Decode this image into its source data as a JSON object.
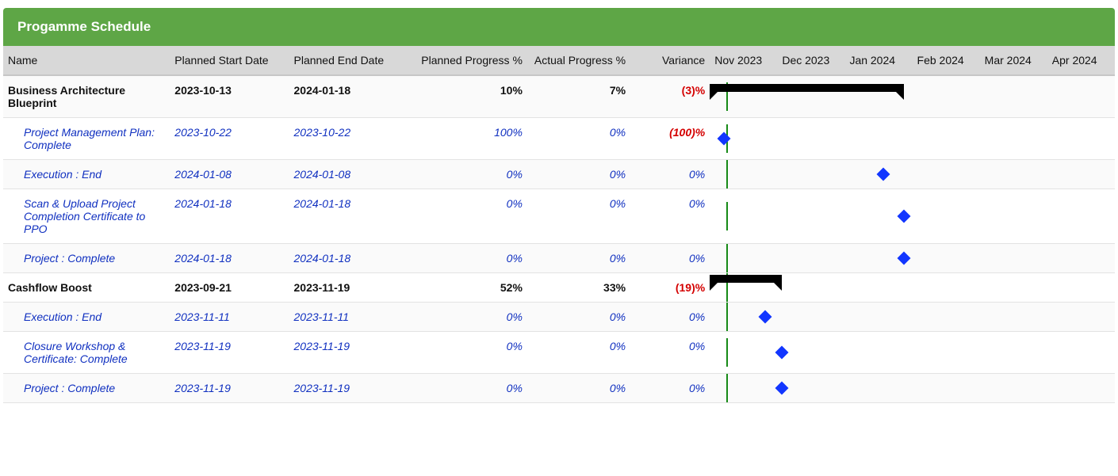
{
  "title": "Progamme Schedule",
  "columns": {
    "name": "Name",
    "planned_start": "Planned Start Date",
    "planned_end": "Planned End Date",
    "planned_progress": "Planned Progress %",
    "actual_progress": "Actual Progress %",
    "variance": "Variance"
  },
  "months": [
    "Nov 2023",
    "Dec 2023",
    "Jan 2024",
    "Feb 2024",
    "Mar 2024",
    "Apr 2024"
  ],
  "timeline": {
    "start": "2023-10-15",
    "end": "2024-04-30",
    "today": "2023-10-23"
  },
  "rows": [
    {
      "type": "summary",
      "name": "Business Architecture Blueprint",
      "planned_start": "2023-10-13",
      "planned_end": "2024-01-18",
      "planned_progress": "10%",
      "actual_progress": "7%",
      "variance": "(3)%",
      "variance_negative": true,
      "bar": {
        "start": "2023-10-13",
        "end": "2024-01-18"
      }
    },
    {
      "type": "child",
      "name": "Project Management Plan: Complete",
      "planned_start": "2023-10-22",
      "planned_end": "2023-10-22",
      "planned_progress": "100%",
      "actual_progress": "0%",
      "variance": "(100)%",
      "variance_negative": true,
      "milestone": "2023-10-22"
    },
    {
      "type": "child",
      "name": "Execution : End",
      "planned_start": "2024-01-08",
      "planned_end": "2024-01-08",
      "planned_progress": "0%",
      "actual_progress": "0%",
      "variance": "0%",
      "variance_negative": false,
      "milestone": "2024-01-08"
    },
    {
      "type": "child",
      "name": "Scan & Upload Project Completion Certificate to PPO",
      "planned_start": "2024-01-18",
      "planned_end": "2024-01-18",
      "planned_progress": "0%",
      "actual_progress": "0%",
      "variance": "0%",
      "variance_negative": false,
      "milestone": "2024-01-18"
    },
    {
      "type": "child",
      "name": "Project : Complete",
      "planned_start": "2024-01-18",
      "planned_end": "2024-01-18",
      "planned_progress": "0%",
      "actual_progress": "0%",
      "variance": "0%",
      "variance_negative": false,
      "milestone": "2024-01-18"
    },
    {
      "type": "summary",
      "name": "Cashflow Boost",
      "planned_start": "2023-09-21",
      "planned_end": "2023-11-19",
      "planned_progress": "52%",
      "actual_progress": "33%",
      "variance": "(19)%",
      "variance_negative": true,
      "bar": {
        "start": "2023-09-21",
        "end": "2023-11-19"
      }
    },
    {
      "type": "child",
      "name": "Execution : End",
      "planned_start": "2023-11-11",
      "planned_end": "2023-11-11",
      "planned_progress": "0%",
      "actual_progress": "0%",
      "variance": "0%",
      "variance_negative": false,
      "milestone": "2023-11-11"
    },
    {
      "type": "child",
      "name": "Closure Workshop & Certificate: Complete",
      "planned_start": "2023-11-19",
      "planned_end": "2023-11-19",
      "planned_progress": "0%",
      "actual_progress": "0%",
      "variance": "0%",
      "variance_negative": false,
      "milestone": "2023-11-19"
    },
    {
      "type": "child",
      "name": "Project : Complete",
      "planned_start": "2023-11-19",
      "planned_end": "2023-11-19",
      "planned_progress": "0%",
      "actual_progress": "0%",
      "variance": "0%",
      "variance_negative": false,
      "milestone": "2023-11-19"
    }
  ],
  "chart_data": {
    "type": "gantt",
    "title": "Progamme Schedule",
    "x_axis": {
      "start": "2023-10-15",
      "end": "2024-04-30",
      "ticks": [
        "Nov 2023",
        "Dec 2023",
        "Jan 2024",
        "Feb 2024",
        "Mar 2024",
        "Apr 2024"
      ]
    },
    "today_marker": "2023-10-23",
    "tasks": [
      {
        "name": "Business Architecture Blueprint",
        "kind": "summary",
        "start": "2023-10-13",
        "end": "2024-01-18",
        "planned_progress_pct": 10,
        "actual_progress_pct": 7,
        "variance_pct": -3
      },
      {
        "name": "Project Management Plan: Complete",
        "kind": "milestone",
        "date": "2023-10-22",
        "parent": "Business Architecture Blueprint",
        "planned_progress_pct": 100,
        "actual_progress_pct": 0,
        "variance_pct": -100
      },
      {
        "name": "Execution : End",
        "kind": "milestone",
        "date": "2024-01-08",
        "parent": "Business Architecture Blueprint",
        "planned_progress_pct": 0,
        "actual_progress_pct": 0,
        "variance_pct": 0
      },
      {
        "name": "Scan & Upload Project Completion Certificate to PPO",
        "kind": "milestone",
        "date": "2024-01-18",
        "parent": "Business Architecture Blueprint",
        "planned_progress_pct": 0,
        "actual_progress_pct": 0,
        "variance_pct": 0
      },
      {
        "name": "Project : Complete",
        "kind": "milestone",
        "date": "2024-01-18",
        "parent": "Business Architecture Blueprint",
        "planned_progress_pct": 0,
        "actual_progress_pct": 0,
        "variance_pct": 0
      },
      {
        "name": "Cashflow Boost",
        "kind": "summary",
        "start": "2023-09-21",
        "end": "2023-11-19",
        "planned_progress_pct": 52,
        "actual_progress_pct": 33,
        "variance_pct": -19
      },
      {
        "name": "Execution : End",
        "kind": "milestone",
        "date": "2023-11-11",
        "parent": "Cashflow Boost",
        "planned_progress_pct": 0,
        "actual_progress_pct": 0,
        "variance_pct": 0
      },
      {
        "name": "Closure Workshop & Certificate: Complete",
        "kind": "milestone",
        "date": "2023-11-19",
        "parent": "Cashflow Boost",
        "planned_progress_pct": 0,
        "actual_progress_pct": 0,
        "variance_pct": 0
      },
      {
        "name": "Project : Complete",
        "kind": "milestone",
        "date": "2023-11-19",
        "parent": "Cashflow Boost",
        "planned_progress_pct": 0,
        "actual_progress_pct": 0,
        "variance_pct": 0
      }
    ]
  }
}
